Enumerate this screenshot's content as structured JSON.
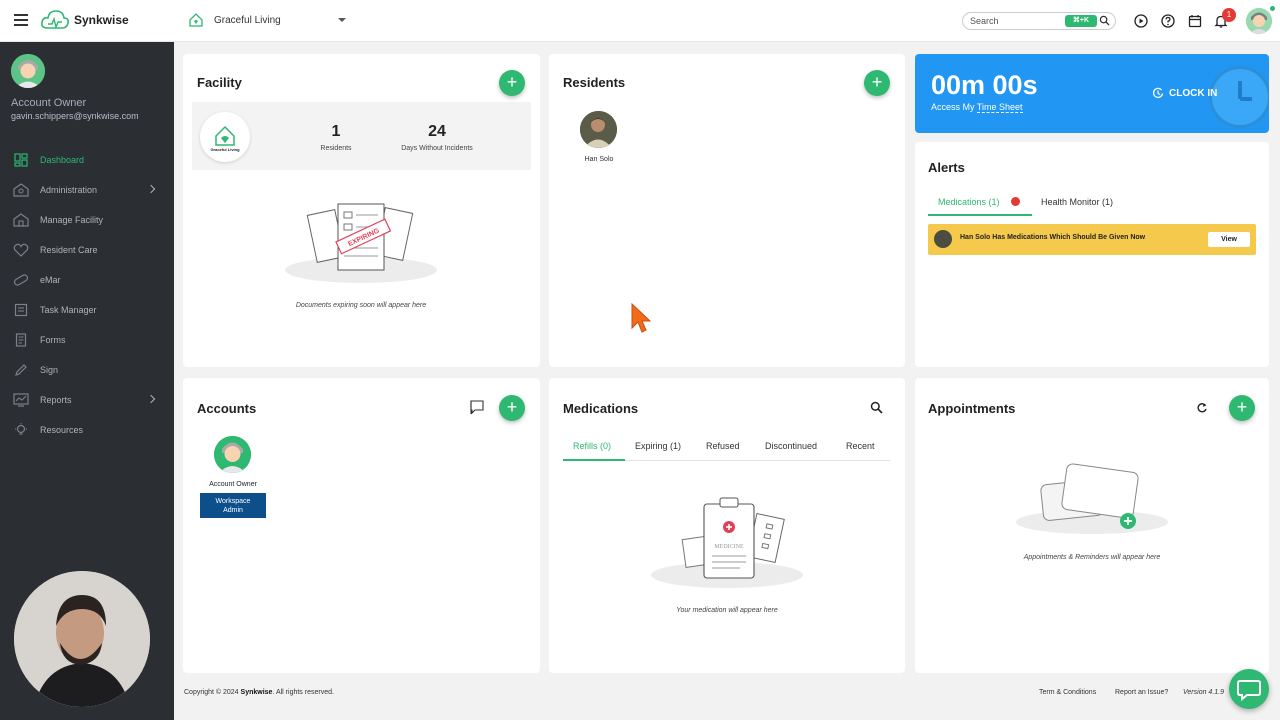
{
  "app": {
    "brand": "Synkwise",
    "facility": "Graceful Living"
  },
  "topbar": {
    "search_placeholder": "Search",
    "shortcut": "⌘+K",
    "notification_count": "1"
  },
  "sidebar": {
    "account_name": "Account Owner",
    "account_email": "gavin.schippers@synkwise.com",
    "items": [
      {
        "label": "Dashboard",
        "icon": "dashboard-icon",
        "active": true
      },
      {
        "label": "Administration",
        "icon": "administration-icon"
      },
      {
        "label": "Manage Facility",
        "icon": "facility-icon"
      },
      {
        "label": "Resident Care",
        "icon": "heart-icon"
      },
      {
        "label": "eMar",
        "icon": "pill-icon"
      },
      {
        "label": "Task Manager",
        "icon": "task-icon"
      },
      {
        "label": "Forms",
        "icon": "forms-icon"
      },
      {
        "label": "Sign",
        "icon": "sign-icon"
      },
      {
        "label": "Reports",
        "icon": "reports-icon"
      },
      {
        "label": "Resources",
        "icon": "lightbulb-icon"
      }
    ]
  },
  "facility_card": {
    "title": "Facility",
    "logo_text": "Graceful Living",
    "residents_count": "1",
    "residents_label": "Residents",
    "days_count": "24",
    "days_label": "Days Without Incidents",
    "stamp_text": "EXPIRING",
    "empty_text": "Documents expiring soon will appear here"
  },
  "residents_card": {
    "title": "Residents",
    "resident_name": "Han Solo"
  },
  "timer_card": {
    "time": "00m 00s",
    "link_prefix": "Access My ",
    "link_text": "Time Sheet",
    "clockin": "CLOCK IN"
  },
  "alerts_card": {
    "title": "Alerts",
    "tab_medications": "Medications (1)",
    "tab_health": "Health Monitor (1)",
    "alert_text": "Han Solo Has Medications Which Should Be Given Now",
    "view_label": "View"
  },
  "accounts_card": {
    "title": "Accounts",
    "owner_label": "Account Owner",
    "role_line1": "Workspace",
    "role_line2": "Admin"
  },
  "medications_card": {
    "title": "Medications",
    "tabs": [
      "Refills (0)",
      "Expiring (1)",
      "Refused",
      "Discontinued",
      "Recent"
    ],
    "illustration_label": "MEDICINE",
    "empty_text": "Your medication will appear here"
  },
  "appointments_card": {
    "title": "Appointments",
    "empty_text": "Appointments & Reminders will appear here"
  },
  "footer": {
    "copyright_prefix": "Copyright © 2024 ",
    "copyright_brand": "Synkwise",
    "copyright_suffix": ". All rights reserved.",
    "terms": "Term & Conditions",
    "report": "Report an Issue?",
    "version": "Version 4.1.9"
  },
  "colors": {
    "accent": "#2eb872",
    "sidebar": "#2b2e33",
    "timer": "#2196f3",
    "alert": "#f5c94c",
    "role": "#0d4f8b"
  }
}
